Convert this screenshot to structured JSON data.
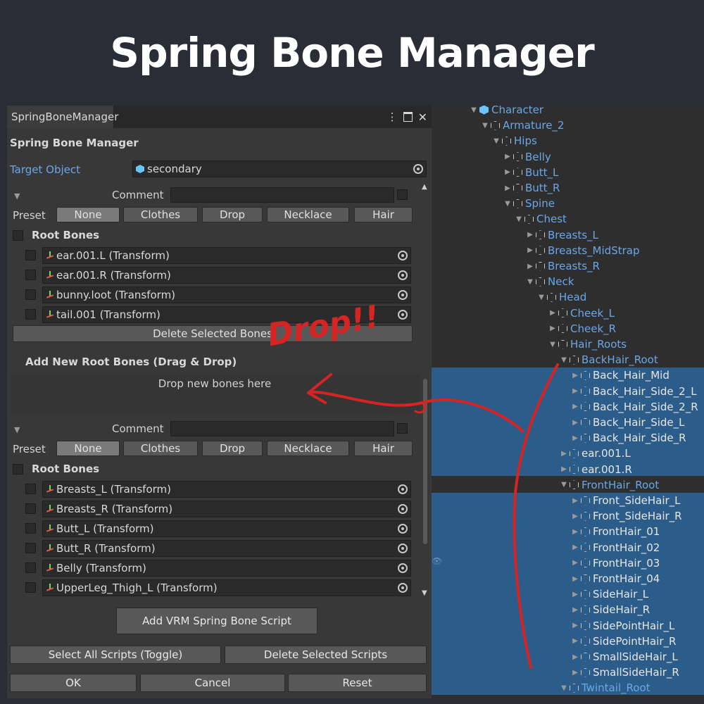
{
  "header": {
    "title": "Spring Bone Manager"
  },
  "window": {
    "tab_label": "SpringBoneManager",
    "panel_title": "Spring Bone Manager",
    "target_label": "Target Object",
    "target_value": "secondary"
  },
  "entries": [
    {
      "comment_label": "Comment",
      "preset_label": "Preset",
      "presets": [
        "None",
        "Clothes",
        "Drop",
        "Necklace",
        "Hair"
      ],
      "active_preset": "None",
      "root_bones_label": "Root Bones",
      "bones": [
        "ear.001.L (Transform)",
        "ear.001.R (Transform)",
        "bunny.loot (Transform)",
        "tail.001 (Transform)"
      ],
      "delete_label": "Delete Selected Bones"
    },
    {
      "comment_label": "Comment",
      "preset_label": "Preset",
      "presets": [
        "None",
        "Clothes",
        "Drop",
        "Necklace",
        "Hair"
      ],
      "active_preset": "None",
      "root_bones_label": "Root Bones",
      "bones": [
        "Breasts_L (Transform)",
        "Breasts_R (Transform)",
        "Butt_L (Transform)",
        "Butt_R (Transform)",
        "Belly (Transform)",
        "UpperLeg_Thigh_L (Transform)"
      ]
    }
  ],
  "add_section": {
    "title": "Add New Root Bones (Drag & Drop)",
    "drop_text": "Drop new bones here"
  },
  "buttons": {
    "add_script": "Add VRM Spring Bone Script",
    "select_all": "Select All Scripts (Toggle)",
    "delete_scripts": "Delete Selected Scripts",
    "ok": "OK",
    "cancel": "Cancel",
    "reset": "Reset"
  },
  "annotation": {
    "text": "Drop!!",
    "color": "#d52424"
  },
  "colors": {
    "accent": "#6aa7e8",
    "selection": "#2c5d8a",
    "panel": "#383838"
  },
  "hierarchy": [
    {
      "name": "Character",
      "depth": 0,
      "expanded": true,
      "color": "blue",
      "icon": "prefab-cube-icon"
    },
    {
      "name": "Armature_2",
      "depth": 1,
      "expanded": true,
      "color": "blue"
    },
    {
      "name": "Hips",
      "depth": 2,
      "expanded": true,
      "color": "blue"
    },
    {
      "name": "Belly",
      "depth": 3,
      "expanded": false,
      "color": "blue"
    },
    {
      "name": "Butt_L",
      "depth": 3,
      "expanded": false,
      "color": "blue"
    },
    {
      "name": "Butt_R",
      "depth": 3,
      "expanded": false,
      "color": "blue"
    },
    {
      "name": "Spine",
      "depth": 3,
      "expanded": true,
      "color": "blue"
    },
    {
      "name": "Chest",
      "depth": 4,
      "expanded": true,
      "color": "blue"
    },
    {
      "name": "Breasts_L",
      "depth": 5,
      "expanded": false,
      "color": "blue"
    },
    {
      "name": "Breasts_MidStrap",
      "depth": 5,
      "expanded": false,
      "color": "blue"
    },
    {
      "name": "Breasts_R",
      "depth": 5,
      "expanded": false,
      "color": "blue"
    },
    {
      "name": "Neck",
      "depth": 5,
      "expanded": true,
      "color": "blue"
    },
    {
      "name": "Head",
      "depth": 6,
      "expanded": true,
      "color": "blue"
    },
    {
      "name": "Cheek_L",
      "depth": 7,
      "expanded": false,
      "color": "blue"
    },
    {
      "name": "Cheek_R",
      "depth": 7,
      "expanded": false,
      "color": "blue"
    },
    {
      "name": "Hair_Roots",
      "depth": 7,
      "expanded": true,
      "color": "blue"
    },
    {
      "name": "BackHair_Root",
      "depth": 8,
      "expanded": true,
      "color": "blue"
    },
    {
      "name": "Back_Hair_Mid",
      "depth": 9,
      "expanded": false,
      "selected": true
    },
    {
      "name": "Back_Hair_Side_2_L",
      "depth": 9,
      "expanded": false,
      "selected": true
    },
    {
      "name": "Back_Hair_Side_2_R",
      "depth": 9,
      "expanded": false,
      "selected": true
    },
    {
      "name": "Back_Hair_Side_L",
      "depth": 9,
      "expanded": false,
      "selected": true
    },
    {
      "name": "Back_Hair_Side_R",
      "depth": 9,
      "expanded": false,
      "selected": true
    },
    {
      "name": "ear.001.L",
      "depth": 8,
      "expanded": false,
      "selected": true
    },
    {
      "name": "ear.001.R",
      "depth": 8,
      "expanded": false,
      "selected": true
    },
    {
      "name": "FrontHair_Root",
      "depth": 8,
      "expanded": true,
      "color": "blue"
    },
    {
      "name": "Front_SideHair_L",
      "depth": 9,
      "expanded": false,
      "selected": true
    },
    {
      "name": "Front_SideHair_R",
      "depth": 9,
      "expanded": false,
      "selected": true
    },
    {
      "name": "FrontHair_01",
      "depth": 9,
      "expanded": false,
      "selected": true
    },
    {
      "name": "FrontHair_02",
      "depth": 9,
      "expanded": false,
      "selected": true
    },
    {
      "name": "FrontHair_03",
      "depth": 9,
      "expanded": false,
      "selected": true
    },
    {
      "name": "FrontHair_04",
      "depth": 9,
      "expanded": false,
      "selected": true
    },
    {
      "name": "SideHair_L",
      "depth": 9,
      "expanded": false,
      "selected": true
    },
    {
      "name": "SideHair_R",
      "depth": 9,
      "expanded": false,
      "selected": true
    },
    {
      "name": "SidePointHair_L",
      "depth": 9,
      "expanded": false,
      "selected": true
    },
    {
      "name": "SidePointHair_R",
      "depth": 9,
      "expanded": false,
      "selected": true
    },
    {
      "name": "SmallSideHair_L",
      "depth": 9,
      "expanded": false,
      "selected": true
    },
    {
      "name": "SmallSideHair_R",
      "depth": 9,
      "expanded": false,
      "selected": true
    },
    {
      "name": "Twintail_Root",
      "depth": 8,
      "expanded": true,
      "color": "blue"
    }
  ]
}
